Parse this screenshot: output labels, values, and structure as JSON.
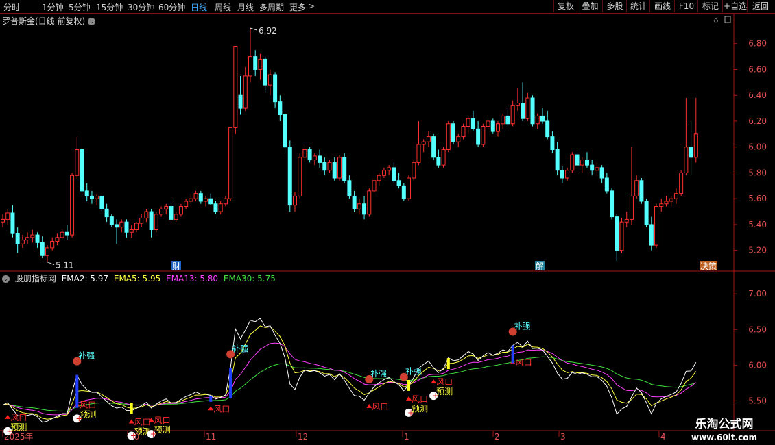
{
  "toolbar": {
    "periods": [
      "分时",
      "1分钟",
      "5分钟",
      "15分钟",
      "30分钟",
      "60分钟",
      "日线",
      "周线",
      "月线",
      "多周期",
      "更多"
    ],
    "active_period": "日线",
    "more_arrow": ">",
    "buttons": [
      "复权",
      "叠加",
      "多股",
      "统计",
      "画线",
      "F10",
      "标记",
      "+自选",
      "返回"
    ]
  },
  "main_chart": {
    "title": "罗普斯金(日线 前复权)",
    "high_label": "6.92",
    "low_label": "5.11",
    "event_markers": [
      "财",
      "解",
      "决策"
    ],
    "y_labels": [
      "6.80",
      "6.60",
      "6.40",
      "6.20",
      "6.00",
      "5.80",
      "5.60",
      "5.40",
      "5.20"
    ],
    "y_ticks": [
      6.8,
      6.6,
      6.4,
      6.2,
      6.0,
      5.8,
      5.6,
      5.4,
      5.2
    ],
    "y_range": [
      5.05,
      7.0
    ]
  },
  "indicator": {
    "name": "股朋指标网",
    "values": [
      {
        "label": "EMA2: 5.97",
        "color": "#ffffff"
      },
      {
        "label": "EMA5: 5.95",
        "color": "#ffff40"
      },
      {
        "label": "EMA13: 5.80",
        "color": "#ff40ff"
      },
      {
        "label": "EMA30: 5.75",
        "color": "#40e040"
      }
    ],
    "y_labels": [
      "7.00",
      "6.50",
      "6.00",
      "5.50"
    ],
    "y_ticks": [
      7.0,
      6.5,
      6.0,
      5.5
    ],
    "y_range": [
      5.1,
      7.3
    ],
    "signal_labels": {
      "strong": "补强",
      "wind": "风口",
      "predict": "预测"
    }
  },
  "x_axis": {
    "labels": [
      "2025年",
      "10",
      "11",
      "12",
      "1",
      "2",
      "3",
      "4"
    ]
  },
  "watermark": {
    "title": "乐淘公式网",
    "url": "www.60lt.com"
  },
  "colors": {
    "up": "#ff3030",
    "down": "#54ffff",
    "ema2": "#ffffff",
    "ema5": "#ffff40",
    "ema13": "#ff40ff",
    "ema30": "#40e040",
    "accent": "#3fa9ff",
    "axis": "#a01818"
  },
  "chart_data": {
    "type": "candlestick",
    "title": "罗普斯金(日线 前复权)",
    "series": [
      {
        "name": "罗普斯金",
        "values": [
          {
            "o": 5.42,
            "h": 5.48,
            "l": 5.38,
            "c": 5.44
          },
          {
            "o": 5.44,
            "h": 5.52,
            "l": 5.4,
            "c": 5.49
          },
          {
            "o": 5.49,
            "h": 5.55,
            "l": 5.3,
            "c": 5.33
          },
          {
            "o": 5.33,
            "h": 5.38,
            "l": 5.18,
            "c": 5.25
          },
          {
            "o": 5.25,
            "h": 5.32,
            "l": 5.22,
            "c": 5.28
          },
          {
            "o": 5.28,
            "h": 5.34,
            "l": 5.25,
            "c": 5.3
          },
          {
            "o": 5.3,
            "h": 5.36,
            "l": 5.26,
            "c": 5.32
          },
          {
            "o": 5.32,
            "h": 5.34,
            "l": 5.22,
            "c": 5.26
          },
          {
            "o": 5.26,
            "h": 5.31,
            "l": 5.14,
            "c": 5.16
          },
          {
            "o": 5.16,
            "h": 5.24,
            "l": 5.11,
            "c": 5.22
          },
          {
            "o": 5.22,
            "h": 5.3,
            "l": 5.2,
            "c": 5.27
          },
          {
            "o": 5.27,
            "h": 5.33,
            "l": 5.24,
            "c": 5.3
          },
          {
            "o": 5.3,
            "h": 5.36,
            "l": 5.28,
            "c": 5.34
          },
          {
            "o": 5.34,
            "h": 5.4,
            "l": 5.28,
            "c": 5.32
          },
          {
            "o": 5.32,
            "h": 5.8,
            "l": 5.3,
            "c": 5.78
          },
          {
            "o": 5.78,
            "h": 6.08,
            "l": 5.75,
            "c": 5.98
          },
          {
            "o": 5.98,
            "h": 5.98,
            "l": 5.62,
            "c": 5.66
          },
          {
            "o": 5.66,
            "h": 5.72,
            "l": 5.58,
            "c": 5.62
          },
          {
            "o": 5.62,
            "h": 5.66,
            "l": 5.56,
            "c": 5.6
          },
          {
            "o": 5.6,
            "h": 5.64,
            "l": 5.55,
            "c": 5.62
          },
          {
            "o": 5.62,
            "h": 5.62,
            "l": 5.5,
            "c": 5.52
          },
          {
            "o": 5.52,
            "h": 5.56,
            "l": 5.42,
            "c": 5.46
          },
          {
            "o": 5.46,
            "h": 5.48,
            "l": 5.38,
            "c": 5.4
          },
          {
            "o": 5.4,
            "h": 5.44,
            "l": 5.25,
            "c": 5.38
          },
          {
            "o": 5.38,
            "h": 5.44,
            "l": 5.34,
            "c": 5.42
          },
          {
            "o": 5.42,
            "h": 5.44,
            "l": 5.3,
            "c": 5.34
          },
          {
            "o": 5.34,
            "h": 5.4,
            "l": 5.3,
            "c": 5.36
          },
          {
            "o": 5.36,
            "h": 5.42,
            "l": 5.34,
            "c": 5.41
          },
          {
            "o": 5.41,
            "h": 5.48,
            "l": 5.38,
            "c": 5.45
          },
          {
            "o": 5.45,
            "h": 5.52,
            "l": 5.42,
            "c": 5.5
          },
          {
            "o": 5.5,
            "h": 5.52,
            "l": 5.3,
            "c": 5.36
          },
          {
            "o": 5.36,
            "h": 5.5,
            "l": 5.34,
            "c": 5.48
          },
          {
            "o": 5.48,
            "h": 5.54,
            "l": 5.46,
            "c": 5.52
          },
          {
            "o": 5.52,
            "h": 5.56,
            "l": 5.48,
            "c": 5.54
          },
          {
            "o": 5.54,
            "h": 5.58,
            "l": 5.4,
            "c": 5.44
          },
          {
            "o": 5.44,
            "h": 5.5,
            "l": 5.42,
            "c": 5.48
          },
          {
            "o": 5.48,
            "h": 5.56,
            "l": 5.46,
            "c": 5.54
          },
          {
            "o": 5.54,
            "h": 5.6,
            "l": 5.52,
            "c": 5.58
          },
          {
            "o": 5.58,
            "h": 5.64,
            "l": 5.56,
            "c": 5.6
          },
          {
            "o": 5.6,
            "h": 5.66,
            "l": 5.58,
            "c": 5.64
          },
          {
            "o": 5.64,
            "h": 5.66,
            "l": 5.56,
            "c": 5.58
          },
          {
            "o": 5.58,
            "h": 5.62,
            "l": 5.54,
            "c": 5.6
          },
          {
            "o": 5.6,
            "h": 5.64,
            "l": 5.55,
            "c": 5.56
          },
          {
            "o": 5.56,
            "h": 5.58,
            "l": 5.48,
            "c": 5.5
          },
          {
            "o": 5.5,
            "h": 5.58,
            "l": 5.48,
            "c": 5.56
          },
          {
            "o": 5.56,
            "h": 5.62,
            "l": 5.54,
            "c": 5.6
          },
          {
            "o": 5.6,
            "h": 6.15,
            "l": 5.58,
            "c": 6.15
          },
          {
            "o": 6.15,
            "h": 6.78,
            "l": 6.1,
            "c": 6.78
          },
          {
            "o": 6.4,
            "h": 6.55,
            "l": 6.25,
            "c": 6.3
          },
          {
            "o": 6.3,
            "h": 6.62,
            "l": 6.28,
            "c": 6.55
          },
          {
            "o": 6.55,
            "h": 6.92,
            "l": 6.5,
            "c": 6.7
          },
          {
            "o": 6.7,
            "h": 6.75,
            "l": 6.55,
            "c": 6.6
          },
          {
            "o": 6.6,
            "h": 6.72,
            "l": 6.52,
            "c": 6.68
          },
          {
            "o": 6.68,
            "h": 6.7,
            "l": 6.42,
            "c": 6.48
          },
          {
            "o": 6.48,
            "h": 6.6,
            "l": 6.4,
            "c": 6.56
          },
          {
            "o": 6.56,
            "h": 6.58,
            "l": 6.3,
            "c": 6.35
          },
          {
            "o": 6.35,
            "h": 6.4,
            "l": 6.2,
            "c": 6.25
          },
          {
            "o": 6.25,
            "h": 6.28,
            "l": 5.95,
            "c": 6.0
          },
          {
            "o": 6.0,
            "h": 6.05,
            "l": 5.5,
            "c": 5.55
          },
          {
            "o": 5.55,
            "h": 5.65,
            "l": 5.5,
            "c": 5.62
          },
          {
            "o": 5.62,
            "h": 5.95,
            "l": 5.6,
            "c": 5.92
          },
          {
            "o": 5.92,
            "h": 6.02,
            "l": 5.88,
            "c": 5.98
          },
          {
            "o": 5.98,
            "h": 6.0,
            "l": 5.88,
            "c": 5.9
          },
          {
            "o": 5.9,
            "h": 5.95,
            "l": 5.86,
            "c": 5.93
          },
          {
            "o": 5.93,
            "h": 5.98,
            "l": 5.84,
            "c": 5.88
          },
          {
            "o": 5.88,
            "h": 5.92,
            "l": 5.78,
            "c": 5.82
          },
          {
            "o": 5.82,
            "h": 5.9,
            "l": 5.8,
            "c": 5.88
          },
          {
            "o": 5.88,
            "h": 5.92,
            "l": 5.74,
            "c": 5.76
          },
          {
            "o": 5.76,
            "h": 5.94,
            "l": 5.74,
            "c": 5.92
          },
          {
            "o": 5.92,
            "h": 5.95,
            "l": 5.72,
            "c": 5.74
          },
          {
            "o": 5.74,
            "h": 5.78,
            "l": 5.6,
            "c": 5.62
          },
          {
            "o": 5.62,
            "h": 5.66,
            "l": 5.5,
            "c": 5.52
          },
          {
            "o": 5.52,
            "h": 5.6,
            "l": 5.48,
            "c": 5.56
          },
          {
            "o": 5.56,
            "h": 5.62,
            "l": 5.44,
            "c": 5.48
          },
          {
            "o": 5.48,
            "h": 5.68,
            "l": 5.46,
            "c": 5.66
          },
          {
            "o": 5.66,
            "h": 5.76,
            "l": 5.64,
            "c": 5.74
          },
          {
            "o": 5.74,
            "h": 5.8,
            "l": 5.7,
            "c": 5.78
          },
          {
            "o": 5.78,
            "h": 5.84,
            "l": 5.76,
            "c": 5.82
          },
          {
            "o": 5.82,
            "h": 5.86,
            "l": 5.78,
            "c": 5.84
          },
          {
            "o": 5.84,
            "h": 5.88,
            "l": 5.72,
            "c": 5.74
          },
          {
            "o": 5.74,
            "h": 5.8,
            "l": 5.68,
            "c": 5.7
          },
          {
            "o": 5.7,
            "h": 5.72,
            "l": 5.58,
            "c": 5.6
          },
          {
            "o": 5.6,
            "h": 5.78,
            "l": 5.58,
            "c": 5.76
          },
          {
            "o": 5.76,
            "h": 5.9,
            "l": 5.74,
            "c": 5.88
          },
          {
            "o": 5.88,
            "h": 6.2,
            "l": 5.86,
            "c": 6.02
          },
          {
            "o": 6.02,
            "h": 6.06,
            "l": 5.96,
            "c": 6.04
          },
          {
            "o": 6.04,
            "h": 6.12,
            "l": 6.0,
            "c": 6.08
          },
          {
            "o": 6.08,
            "h": 6.1,
            "l": 5.9,
            "c": 5.92
          },
          {
            "o": 5.92,
            "h": 5.98,
            "l": 5.84,
            "c": 5.86
          },
          {
            "o": 5.86,
            "h": 6.0,
            "l": 5.84,
            "c": 5.98
          },
          {
            "o": 5.98,
            "h": 6.2,
            "l": 5.96,
            "c": 6.18
          },
          {
            "o": 6.18,
            "h": 6.2,
            "l": 6.02,
            "c": 6.04
          },
          {
            "o": 6.04,
            "h": 6.1,
            "l": 6.0,
            "c": 6.08
          },
          {
            "o": 6.08,
            "h": 6.18,
            "l": 6.06,
            "c": 6.16
          },
          {
            "o": 6.16,
            "h": 6.24,
            "l": 6.1,
            "c": 6.22
          },
          {
            "o": 6.22,
            "h": 6.28,
            "l": 6.12,
            "c": 6.14
          },
          {
            "o": 6.14,
            "h": 6.2,
            "l": 6.0,
            "c": 6.02
          },
          {
            "o": 6.02,
            "h": 6.18,
            "l": 6.0,
            "c": 6.16
          },
          {
            "o": 6.16,
            "h": 6.22,
            "l": 6.12,
            "c": 6.2
          },
          {
            "o": 6.2,
            "h": 6.22,
            "l": 6.1,
            "c": 6.12
          },
          {
            "o": 6.12,
            "h": 6.2,
            "l": 6.08,
            "c": 6.18
          },
          {
            "o": 6.18,
            "h": 6.26,
            "l": 6.14,
            "c": 6.24
          },
          {
            "o": 6.24,
            "h": 6.3,
            "l": 6.16,
            "c": 6.18
          },
          {
            "o": 6.18,
            "h": 6.36,
            "l": 6.16,
            "c": 6.32
          },
          {
            "o": 6.32,
            "h": 6.46,
            "l": 6.28,
            "c": 6.34
          },
          {
            "o": 6.34,
            "h": 6.5,
            "l": 6.2,
            "c": 6.22
          },
          {
            "o": 6.22,
            "h": 6.42,
            "l": 6.2,
            "c": 6.38
          },
          {
            "o": 6.38,
            "h": 6.4,
            "l": 6.16,
            "c": 6.18
          },
          {
            "o": 6.18,
            "h": 6.26,
            "l": 6.14,
            "c": 6.24
          },
          {
            "o": 6.24,
            "h": 6.3,
            "l": 6.18,
            "c": 6.2
          },
          {
            "o": 6.2,
            "h": 6.28,
            "l": 6.06,
            "c": 6.08
          },
          {
            "o": 6.08,
            "h": 6.12,
            "l": 5.95,
            "c": 5.98
          },
          {
            "o": 5.98,
            "h": 6.04,
            "l": 5.78,
            "c": 5.82
          },
          {
            "o": 5.82,
            "h": 5.85,
            "l": 5.72,
            "c": 5.76
          },
          {
            "o": 5.76,
            "h": 5.84,
            "l": 5.74,
            "c": 5.82
          },
          {
            "o": 5.82,
            "h": 5.96,
            "l": 5.8,
            "c": 5.94
          },
          {
            "o": 5.94,
            "h": 5.98,
            "l": 5.82,
            "c": 5.86
          },
          {
            "o": 5.86,
            "h": 5.92,
            "l": 5.8,
            "c": 5.9
          },
          {
            "o": 5.9,
            "h": 5.96,
            "l": 5.84,
            "c": 5.86
          },
          {
            "o": 5.86,
            "h": 5.9,
            "l": 5.78,
            "c": 5.82
          },
          {
            "o": 5.82,
            "h": 5.88,
            "l": 5.78,
            "c": 5.84
          },
          {
            "o": 5.84,
            "h": 5.86,
            "l": 5.72,
            "c": 5.76
          },
          {
            "o": 5.76,
            "h": 5.8,
            "l": 5.64,
            "c": 5.66
          },
          {
            "o": 5.66,
            "h": 5.68,
            "l": 5.44,
            "c": 5.46
          },
          {
            "o": 5.46,
            "h": 5.48,
            "l": 5.12,
            "c": 5.2
          },
          {
            "o": 5.2,
            "h": 5.45,
            "l": 5.18,
            "c": 5.42
          },
          {
            "o": 5.42,
            "h": 5.5,
            "l": 5.38,
            "c": 5.44
          },
          {
            "o": 5.44,
            "h": 6.0,
            "l": 5.4,
            "c": 5.62
          },
          {
            "o": 5.62,
            "h": 5.78,
            "l": 5.6,
            "c": 5.74
          },
          {
            "o": 5.74,
            "h": 5.76,
            "l": 5.56,
            "c": 5.58
          },
          {
            "o": 5.58,
            "h": 5.6,
            "l": 5.38,
            "c": 5.4
          },
          {
            "o": 5.4,
            "h": 5.46,
            "l": 5.2,
            "c": 5.24
          },
          {
            "o": 5.24,
            "h": 5.56,
            "l": 5.22,
            "c": 5.54
          },
          {
            "o": 5.54,
            "h": 5.6,
            "l": 5.5,
            "c": 5.56
          },
          {
            "o": 5.56,
            "h": 5.62,
            "l": 5.54,
            "c": 5.58
          },
          {
            "o": 5.58,
            "h": 5.62,
            "l": 5.54,
            "c": 5.6
          },
          {
            "o": 5.6,
            "h": 5.68,
            "l": 5.56,
            "c": 5.64
          },
          {
            "o": 5.64,
            "h": 5.82,
            "l": 5.62,
            "c": 5.8
          },
          {
            "o": 5.8,
            "h": 6.38,
            "l": 5.78,
            "c": 6.0
          },
          {
            "o": 6.0,
            "h": 6.2,
            "l": 5.78,
            "c": 5.92
          },
          {
            "o": 5.92,
            "h": 6.38,
            "l": 5.88,
            "c": 6.1
          }
        ]
      }
    ],
    "ylim": [
      5.05,
      7.0
    ],
    "grid": false
  }
}
